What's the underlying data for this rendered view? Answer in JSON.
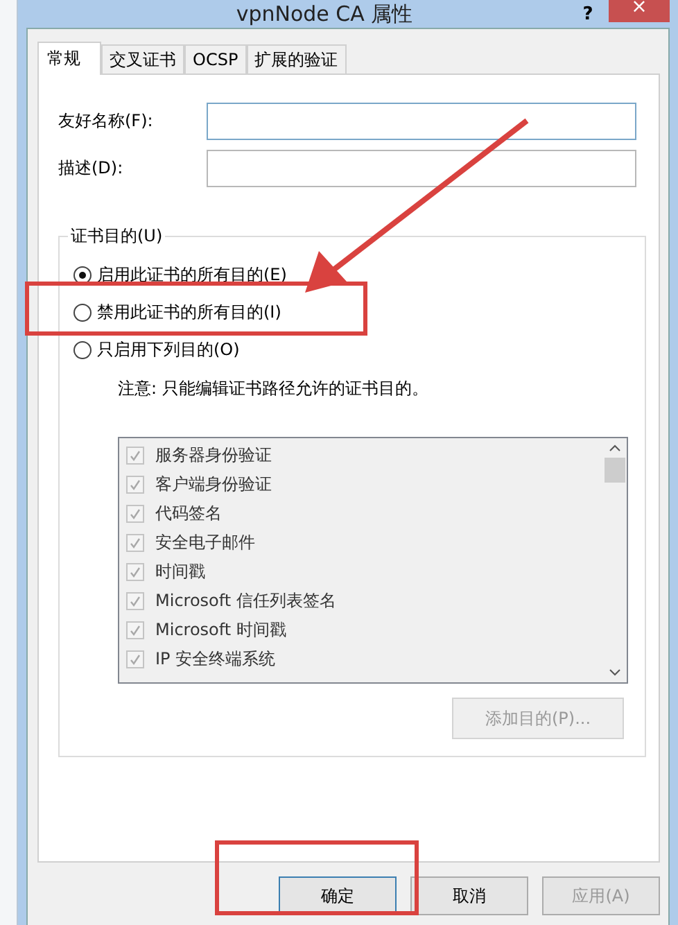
{
  "window": {
    "title": "vpnNode CA 属性",
    "help": "?",
    "close": "×"
  },
  "tabs": [
    {
      "label": "常规",
      "selected": true
    },
    {
      "label": "交叉证书",
      "selected": false
    },
    {
      "label": "OCSP",
      "selected": false
    },
    {
      "label": "扩展的验证",
      "selected": false
    }
  ],
  "fields": [
    {
      "label": "友好名称(F):",
      "focused": true
    },
    {
      "label": "描述(D):",
      "focused": false
    }
  ],
  "purpose_group": {
    "legend": "证书目的(U)",
    "options": [
      {
        "label": "启用此证书的所有目的(E)",
        "selected": true
      },
      {
        "label": "禁用此证书的所有目的(I)",
        "selected": false
      },
      {
        "label": "只启用下列目的(O)",
        "selected": false
      }
    ],
    "note": "注意: 只能编辑证书路径允许的证书目的。",
    "purposes": [
      {
        "label": "服务器身份验证",
        "checked": true,
        "disabled": true
      },
      {
        "label": "客户端身份验证",
        "checked": true,
        "disabled": true
      },
      {
        "label": "代码签名",
        "checked": true,
        "disabled": true
      },
      {
        "label": "安全电子邮件",
        "checked": true,
        "disabled": true
      },
      {
        "label": "时间戳",
        "checked": true,
        "disabled": true
      },
      {
        "label": "Microsoft 信任列表签名",
        "checked": true,
        "disabled": true
      },
      {
        "label": "Microsoft 时间戳",
        "checked": true,
        "disabled": true
      },
      {
        "label": "IP 安全终端系统",
        "checked": true,
        "disabled": true
      }
    ],
    "add_button": {
      "label": "添加目的(P)...",
      "disabled": true
    }
  },
  "buttons": [
    {
      "label": "确定",
      "default": true,
      "disabled": false
    },
    {
      "label": "取消",
      "default": false,
      "disabled": false
    },
    {
      "label": "应用(A)",
      "default": false,
      "disabled": true
    }
  ]
}
